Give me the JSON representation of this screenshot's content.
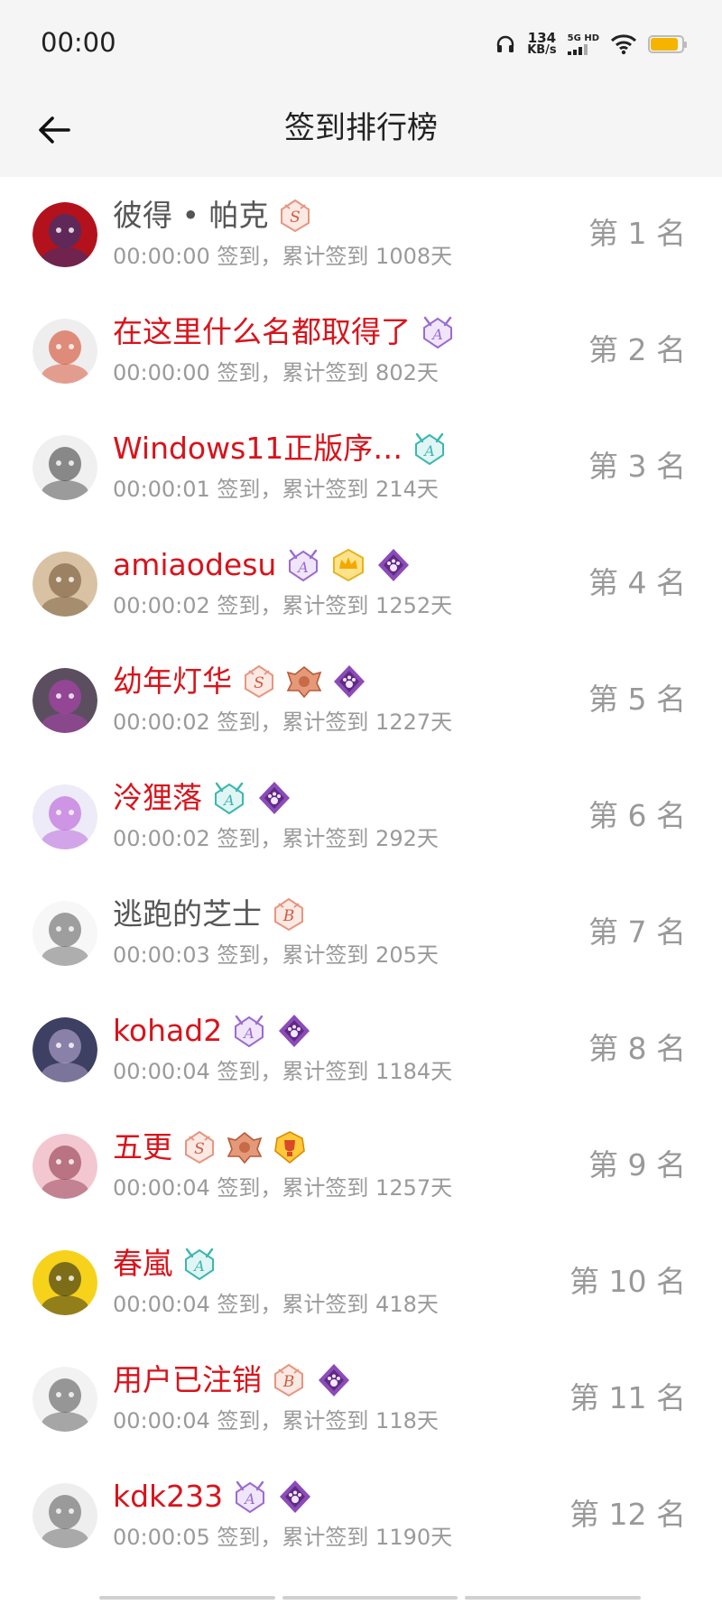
{
  "status": {
    "time": "00:00",
    "speed_value": "134",
    "speed_unit": "KB/s",
    "network": "5G HD"
  },
  "header": {
    "title": "签到排行榜"
  },
  "rows": [
    {
      "name": "彼得 • 帕克",
      "name_color": "gray",
      "checkin_text": "00:00:00 签到，累计签到 1008天",
      "rank": "第 1 名",
      "badges": [
        "s-badge-icon"
      ]
    },
    {
      "name": "在这里什么名都取得了",
      "name_color": "red",
      "checkin_text": "00:00:00 签到，累计签到 802天",
      "rank": "第 2 名",
      "badges": [
        "a-cat-badge-purple-icon"
      ]
    },
    {
      "name": "Windows11正版序…",
      "name_color": "red",
      "checkin_text": "00:00:01 签到，累计签到 214天",
      "rank": "第 3 名",
      "badges": [
        "a-cat-badge-teal-icon"
      ]
    },
    {
      "name": "amiaodesu",
      "name_color": "red",
      "checkin_text": "00:00:02 签到，累计签到 1252天",
      "rank": "第 4 名",
      "badges": [
        "a-cat-badge-purple-icon",
        "gold-crown-badge-icon",
        "paw-diamond-badge-icon"
      ]
    },
    {
      "name": "幼年灯华",
      "name_color": "red",
      "checkin_text": "00:00:02 签到，累计签到 1227天",
      "rank": "第 5 名",
      "badges": [
        "s-badge-icon",
        "bronze-wing-badge-icon",
        "paw-diamond-badge-icon"
      ]
    },
    {
      "name": "泠狸落",
      "name_color": "red",
      "checkin_text": "00:00:02 签到，累计签到 292天",
      "rank": "第 6 名",
      "badges": [
        "a-cat-badge-teal-icon",
        "paw-diamond-badge-icon"
      ]
    },
    {
      "name": "逃跑的芝士",
      "name_color": "gray",
      "checkin_text": "00:00:03 签到，累计签到 205天",
      "rank": "第 7 名",
      "badges": [
        "b-badge-icon"
      ]
    },
    {
      "name": "kohad2",
      "name_color": "red",
      "checkin_text": "00:00:04 签到，累计签到 1184天",
      "rank": "第 8 名",
      "badges": [
        "a-cat-badge-purple-icon",
        "paw-diamond-badge-icon"
      ]
    },
    {
      "name": "五更",
      "name_color": "red",
      "checkin_text": "00:00:04 签到，累计签到 1257天",
      "rank": "第 9 名",
      "badges": [
        "s-badge-icon",
        "bronze-wing-badge-icon",
        "gold-trophy-badge-icon"
      ]
    },
    {
      "name": "春嵐",
      "name_color": "red",
      "checkin_text": "00:00:04 签到，累计签到 418天",
      "rank": "第 10 名",
      "badges": [
        "a-cat-badge-teal-icon"
      ]
    },
    {
      "name": "用户已注销",
      "name_color": "red",
      "checkin_text": "00:00:04 签到，累计签到 118天",
      "rank": "第 11 名",
      "badges": [
        "b-badge-icon",
        "paw-diamond-badge-icon"
      ]
    },
    {
      "name": "kdk233",
      "name_color": "red",
      "checkin_text": "00:00:05 签到，累计签到 1190天",
      "rank": "第 12 名",
      "badges": [
        "a-cat-badge-purple-icon",
        "paw-diamond-badge-icon"
      ]
    }
  ],
  "colors": {
    "name_red": "#d9131b",
    "name_gray": "#555555",
    "sub_text": "#9a9a9a",
    "rank": "#999999",
    "header_bg": "#f5f5f5"
  }
}
